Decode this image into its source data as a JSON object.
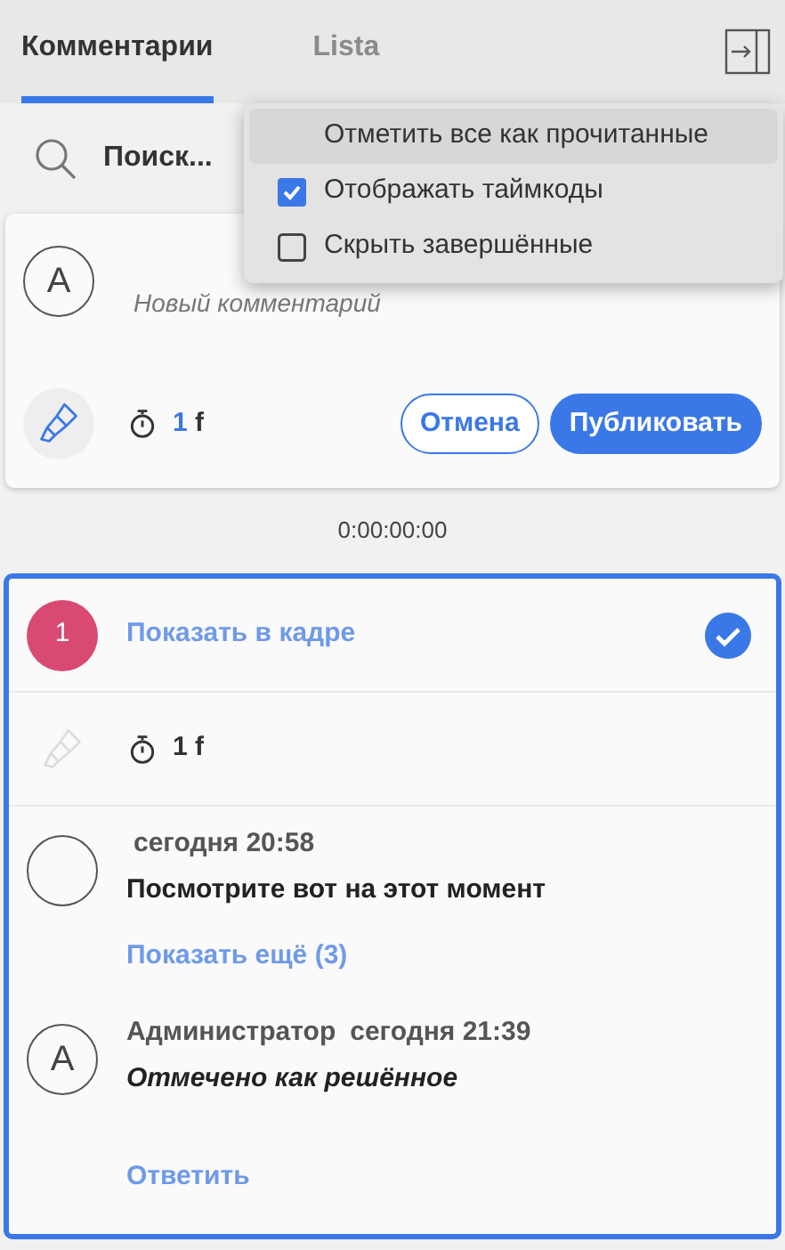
{
  "tabs": [
    {
      "label": "Комментарии",
      "selected": true
    },
    {
      "label": "Lista",
      "selected": false
    }
  ],
  "search": {
    "placeholder": "Поиск..."
  },
  "new_comment": {
    "avatar": "A",
    "placeholder": "Новый комментарий",
    "frames": "1",
    "unit": "f",
    "buttons": [
      {
        "label": "Отмена",
        "kind": "outline"
      },
      {
        "label": "Публиковать",
        "kind": "primary"
      }
    ]
  },
  "timecode": "0:00:00:00",
  "thread": {
    "number": "1",
    "show_in_frame": "Показать в кадре",
    "resolved": true,
    "frames": "1 f",
    "comments": [
      {
        "time": "сегодня 20:58",
        "text": "Посмотрите вот на этот момент",
        "italic": false
      },
      {
        "avatar": "A",
        "author": "Администратор",
        "time": "сегодня 21:39",
        "text": "Отмечено как решённое",
        "italic": true
      }
    ],
    "show_more": "Показать ещё (3)",
    "reply": "Ответить"
  },
  "menu": [
    {
      "kind": "action",
      "label": "Отметить все как прочитанные",
      "selected": true
    },
    {
      "kind": "checkbox",
      "label": "Отображать таймкоды",
      "checked": true,
      "selected": false
    },
    {
      "kind": "checkbox",
      "label": "Скрыть завершённые",
      "checked": false,
      "selected": false
    }
  ]
}
